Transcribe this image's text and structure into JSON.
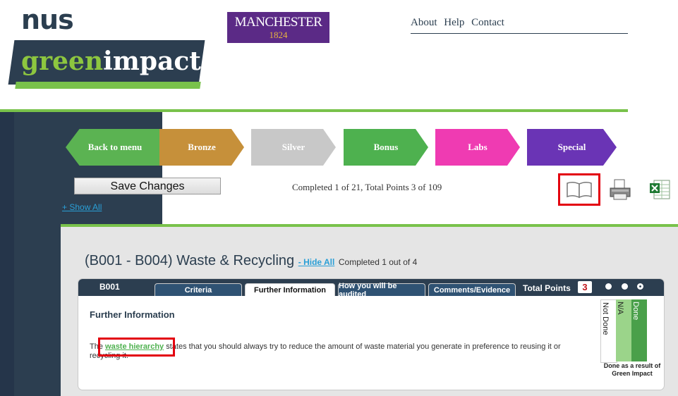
{
  "header": {
    "nus_logo": "nus",
    "green_impact_logo": {
      "green": "green",
      "impact": "impact"
    },
    "manchester": {
      "name": "MANCHESTER",
      "year": "1824"
    },
    "nav": [
      "About",
      "Help",
      "Contact"
    ]
  },
  "levels": [
    {
      "label": "Back to menu",
      "color": "#5bb352"
    },
    {
      "label": "Bronze",
      "color": "#c6903a"
    },
    {
      "label": "Silver",
      "color": "#c8c8c8"
    },
    {
      "label": "Bonus",
      "color": "#4eb14f"
    },
    {
      "label": "Labs",
      "color": "#ef3bb2"
    },
    {
      "label": "Special",
      "color": "#6a34b5"
    }
  ],
  "toolbar": {
    "save_label": "Save Changes",
    "show_all": "+ Show All",
    "progress": "Completed 1 of 21, Total Points 3 of 109",
    "icons": [
      "book-icon",
      "printer-icon",
      "excel-icon"
    ]
  },
  "section": {
    "title": "(B001 - B004) Waste & Recycling",
    "hide_all": "- Hide All",
    "completed": "Completed 1 out of 4"
  },
  "card": {
    "code": "B001",
    "tabs": [
      "Criteria",
      "Further Information",
      "How you will be audited",
      "Comments/Evidence"
    ],
    "total_label": "Total Points",
    "total_value": "3",
    "further_title": "Further Information",
    "text_before": "The ",
    "link": "waste hierarchy",
    "text_after": " states that you should always try to reduce the amount of waste material you generate in preference to reusing it or recycling it.",
    "status_columns": [
      "Not Done",
      "N/A",
      "Done"
    ],
    "result_label": "Done as a result of Green Impact"
  },
  "colors": {
    "accent_green": "#79c24b",
    "navy": "#2c3e50",
    "link_blue": "#2a9fd6",
    "highlight_red": "#e3000f"
  }
}
